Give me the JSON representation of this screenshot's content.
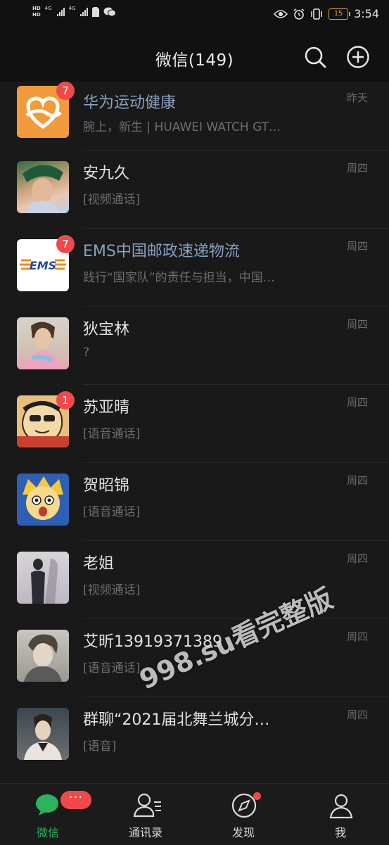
{
  "status_bar": {
    "sim1": "HD",
    "sim2": "HD",
    "net1": "4G",
    "net2": "4G",
    "battery": "15",
    "time": "3:54"
  },
  "header": {
    "title": "微信(149)"
  },
  "chats": [
    {
      "name": "华为运动健康",
      "preview": "腕上，新生 | HUAWEI WATCH GT…",
      "time": "昨天",
      "badge": "7",
      "official": true,
      "avatar": "huawei-health-logo"
    },
    {
      "name": "安九久",
      "preview": "[视频通话]",
      "time": "周四",
      "badge": "",
      "official": false,
      "avatar": "photo"
    },
    {
      "name": "EMS中国邮政速递物流",
      "preview": "践行“国家队”的责任与担当，中国…",
      "time": "周四",
      "badge": "7",
      "official": true,
      "avatar": "ems-logo",
      "avatar_text": "EMS"
    },
    {
      "name": "狄宝林",
      "preview": "?",
      "time": "周四",
      "badge": "",
      "official": false,
      "avatar": "photo"
    },
    {
      "name": "苏亚晴",
      "preview": "[语音通话]",
      "time": "周四",
      "badge": "1",
      "official": false,
      "avatar": "cartoon"
    },
    {
      "name": "贺昭锦",
      "preview": "[语音通话]",
      "time": "周四",
      "badge": "",
      "official": false,
      "avatar": "anime"
    },
    {
      "name": "老姐",
      "preview": "[视频通话]",
      "time": "周四",
      "badge": "",
      "official": false,
      "avatar": "photo"
    },
    {
      "name": "艾昕13919371389",
      "preview": "[语音通话]",
      "time": "周四",
      "badge": "",
      "official": false,
      "avatar": "illustration"
    },
    {
      "name": "群聊“2021届北舞兰城分…",
      "preview": "[语音]",
      "time": "周四",
      "badge": "",
      "official": false,
      "avatar": "photo"
    }
  ],
  "watermark": "998.su看完整版",
  "tabs": [
    {
      "label": "微信",
      "active": true,
      "badge": "···"
    },
    {
      "label": "通讯录",
      "active": false
    },
    {
      "label": "发现",
      "active": false,
      "dot": true
    },
    {
      "label": "我",
      "active": false
    }
  ],
  "colors": {
    "accent": "#2db35c",
    "badge": "#f0494b",
    "background": "#111111"
  }
}
